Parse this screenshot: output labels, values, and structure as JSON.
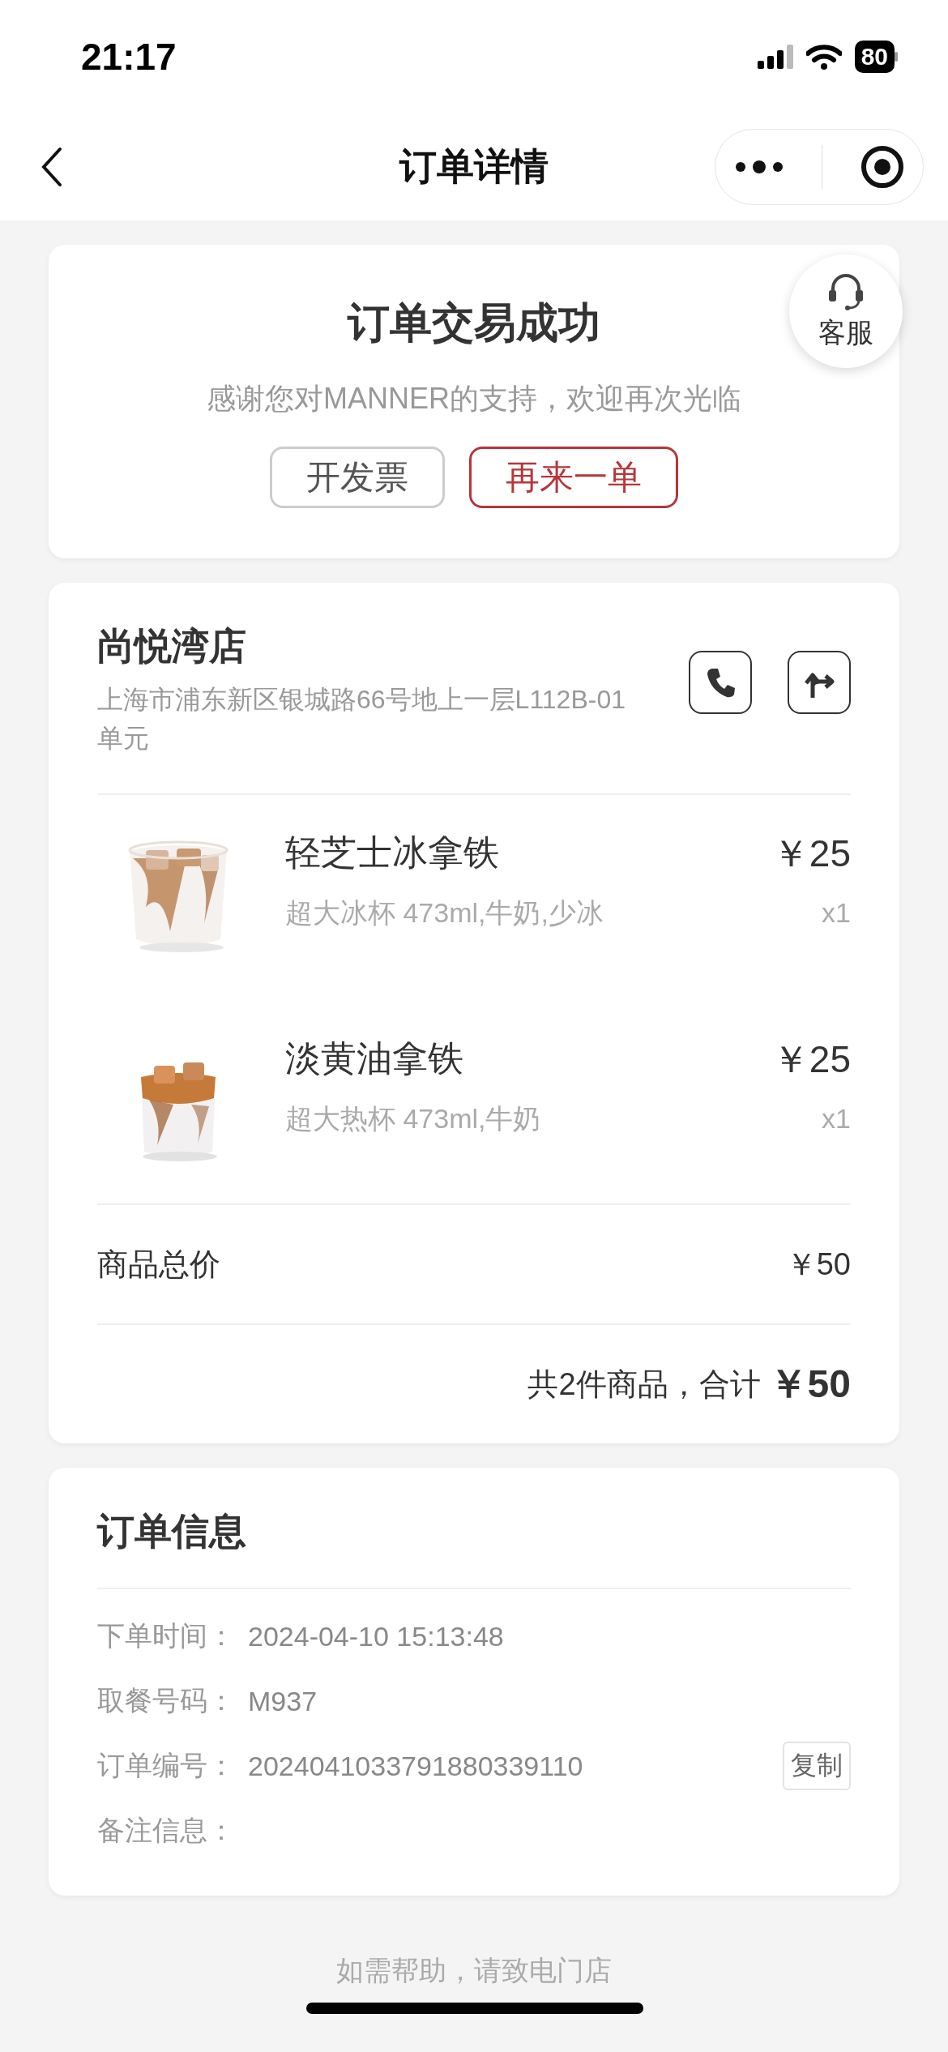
{
  "status_bar": {
    "time": "21:17",
    "battery": "80"
  },
  "nav": {
    "title": "订单详情"
  },
  "result": {
    "title": "订单交易成功",
    "message": "感谢您对MANNER的支持，欢迎再次光临",
    "service": "客服",
    "buttons": [
      {
        "label": "开发票",
        "kind": "plain"
      },
      {
        "label": "再来一单",
        "kind": "primary"
      }
    ]
  },
  "store": {
    "name": "尚悦湾店",
    "address": "上海市浦东新区银城路66号地上一层L112B-01单元",
    "items": [
      {
        "name": "轻芝士冰拿铁",
        "options": "超大冰杯 473ml,牛奶,少冰",
        "price": "￥25",
        "quantity": "x1",
        "kind": "picture"
      },
      {
        "name": "淡黄油拿铁",
        "options": "超大热杯 473ml,牛奶",
        "price": "￥25",
        "quantity": "x1",
        "kind": "picture"
      }
    ],
    "subtotal": {
      "label": "商品总价",
      "value": "￥50"
    },
    "total": {
      "label": "共2件商品，合计",
      "value": "￥50"
    }
  },
  "order_info": {
    "title": "订单信息",
    "rows": [
      {
        "label": "下单时间：",
        "value": "2024-04-10 15:13:48"
      },
      {
        "label": "取餐号码：",
        "value": "M937"
      },
      {
        "label": "订单编号：",
        "value": "2024041033791880339110",
        "action": "复制"
      },
      {
        "label": "备注信息："
      }
    ]
  },
  "footer": "如需帮助，请致电门店"
}
